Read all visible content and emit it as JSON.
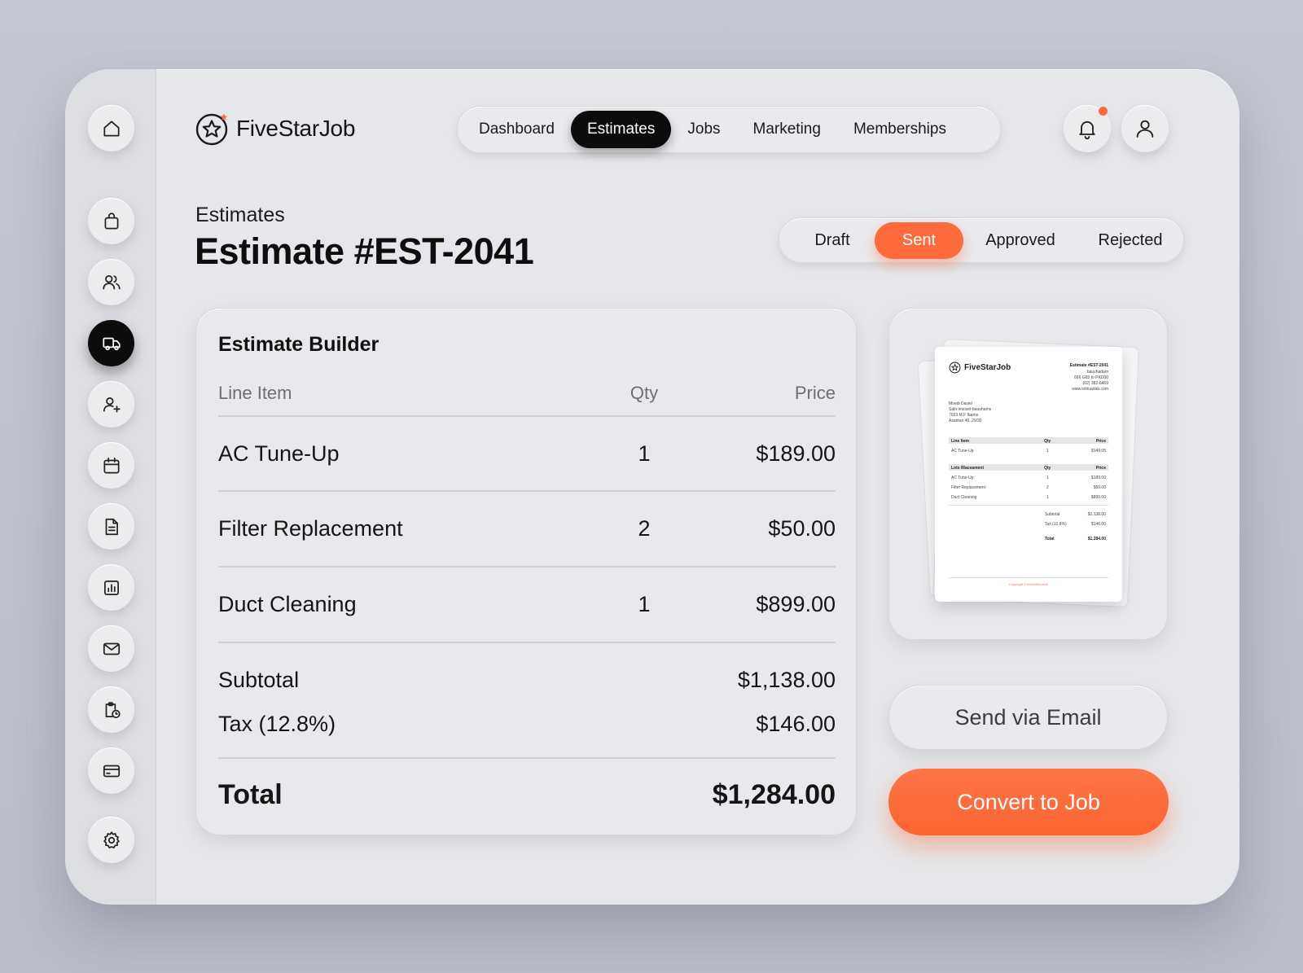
{
  "brand": {
    "name": "FiveStarJob",
    "accent": "#ff6b3d",
    "dark": "#0c0c0c"
  },
  "rail": {
    "items": [
      {
        "icon": "home-icon",
        "active": false
      },
      {
        "icon": "briefcase-icon",
        "active": false
      },
      {
        "icon": "users-icon",
        "active": false
      },
      {
        "icon": "truck-icon",
        "active": true
      },
      {
        "icon": "user-plus-icon",
        "active": false
      },
      {
        "icon": "calendar-icon",
        "active": false
      },
      {
        "icon": "document-icon",
        "active": false
      },
      {
        "icon": "bar-chart-icon",
        "active": false
      },
      {
        "icon": "mail-icon",
        "active": false
      },
      {
        "icon": "clipboard-clock-icon",
        "active": false
      },
      {
        "icon": "credit-card-icon",
        "active": false
      },
      {
        "icon": "settings-icon",
        "active": false
      }
    ]
  },
  "nav": {
    "items": [
      "Dashboard",
      "Estimates",
      "Jobs",
      "Marketing",
      "Memberships"
    ],
    "active": "Estimates"
  },
  "header": {
    "breadcrumb": "Estimates",
    "title": "Estimate #EST-2041"
  },
  "status": {
    "options": [
      "Draft",
      "Sent",
      "Approved",
      "Rejected"
    ],
    "active": "Sent"
  },
  "builder": {
    "title": "Estimate Builder",
    "columns": {
      "item": "Line Item",
      "qty": "Qty",
      "price": "Price"
    },
    "rows": [
      {
        "item": "AC Tune-Up",
        "qty": "1",
        "price": "$189.00"
      },
      {
        "item": "Filter Replacement",
        "qty": "2",
        "price": "$50.00"
      },
      {
        "item": "Duct Cleaning",
        "qty": "1",
        "price": "$899.00"
      }
    ],
    "subtotal_label": "Subtotal",
    "subtotal_value": "$1,138.00",
    "tax_label": "Tax (12.8%)",
    "tax_value": "$146.00",
    "total_label": "Total",
    "total_value": "$1,284.00"
  },
  "preview": {
    "brand": "FiveStarJob",
    "estimate_no": "Estimate #EST-2041",
    "header_lines": [
      "bauvhadam",
      "666 G65 to PKD00",
      "(02) 382-6469",
      "www.tohiuadab.com"
    ],
    "client_lines": [
      "Moedi Daviel",
      "Salo-lmiosel-bauuhams",
      "7023 M.F Ibams",
      "Asantan 46..29/30"
    ],
    "table1_header": [
      "Line Item",
      "Qty",
      "Price"
    ],
    "table1_rows": [
      [
        "AC Tune-Up",
        "1",
        "$149.05"
      ]
    ],
    "table2_header": [
      "Lots Rlaceament",
      "Qty",
      "Price"
    ],
    "table2_rows": [
      [
        "AC Tune-Up",
        "1",
        "$189.00"
      ],
      [
        "Filter Replacement",
        "2",
        "$50.00"
      ],
      [
        "Duct Cleaning",
        "1",
        "$899.00"
      ]
    ],
    "subtotal": [
      "Subtotal",
      "$1,138.00"
    ],
    "tax": [
      "Tax (12.8%)",
      "$146.00"
    ],
    "total": [
      "Total",
      "$1,284.00"
    ],
    "footer": "Copyright © fiveaHbenatob"
  },
  "actions": {
    "email": "Send via Email",
    "convert": "Convert to Job"
  }
}
